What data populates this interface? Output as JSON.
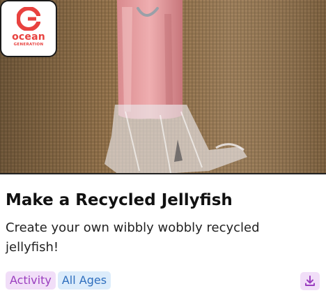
{
  "card": {
    "image_alt": "Recycled jellyfish craft on burlap",
    "logo": {
      "line1": "ocean",
      "line2": "GENERATION"
    },
    "title": "Make a Recycled Jellyfish",
    "description": "Create your own wibbly wobbly recycled jellyfish!",
    "tags": [
      "Activity",
      "All Ages"
    ],
    "download_icon": "download-icon"
  },
  "colors": {
    "brand_red": "#e8423f",
    "tag_activity_bg": "#f1def8",
    "tag_activity_text": "#9b3fbf",
    "tag_ages_bg": "#dcecfb",
    "tag_ages_text": "#2f6fbe"
  }
}
